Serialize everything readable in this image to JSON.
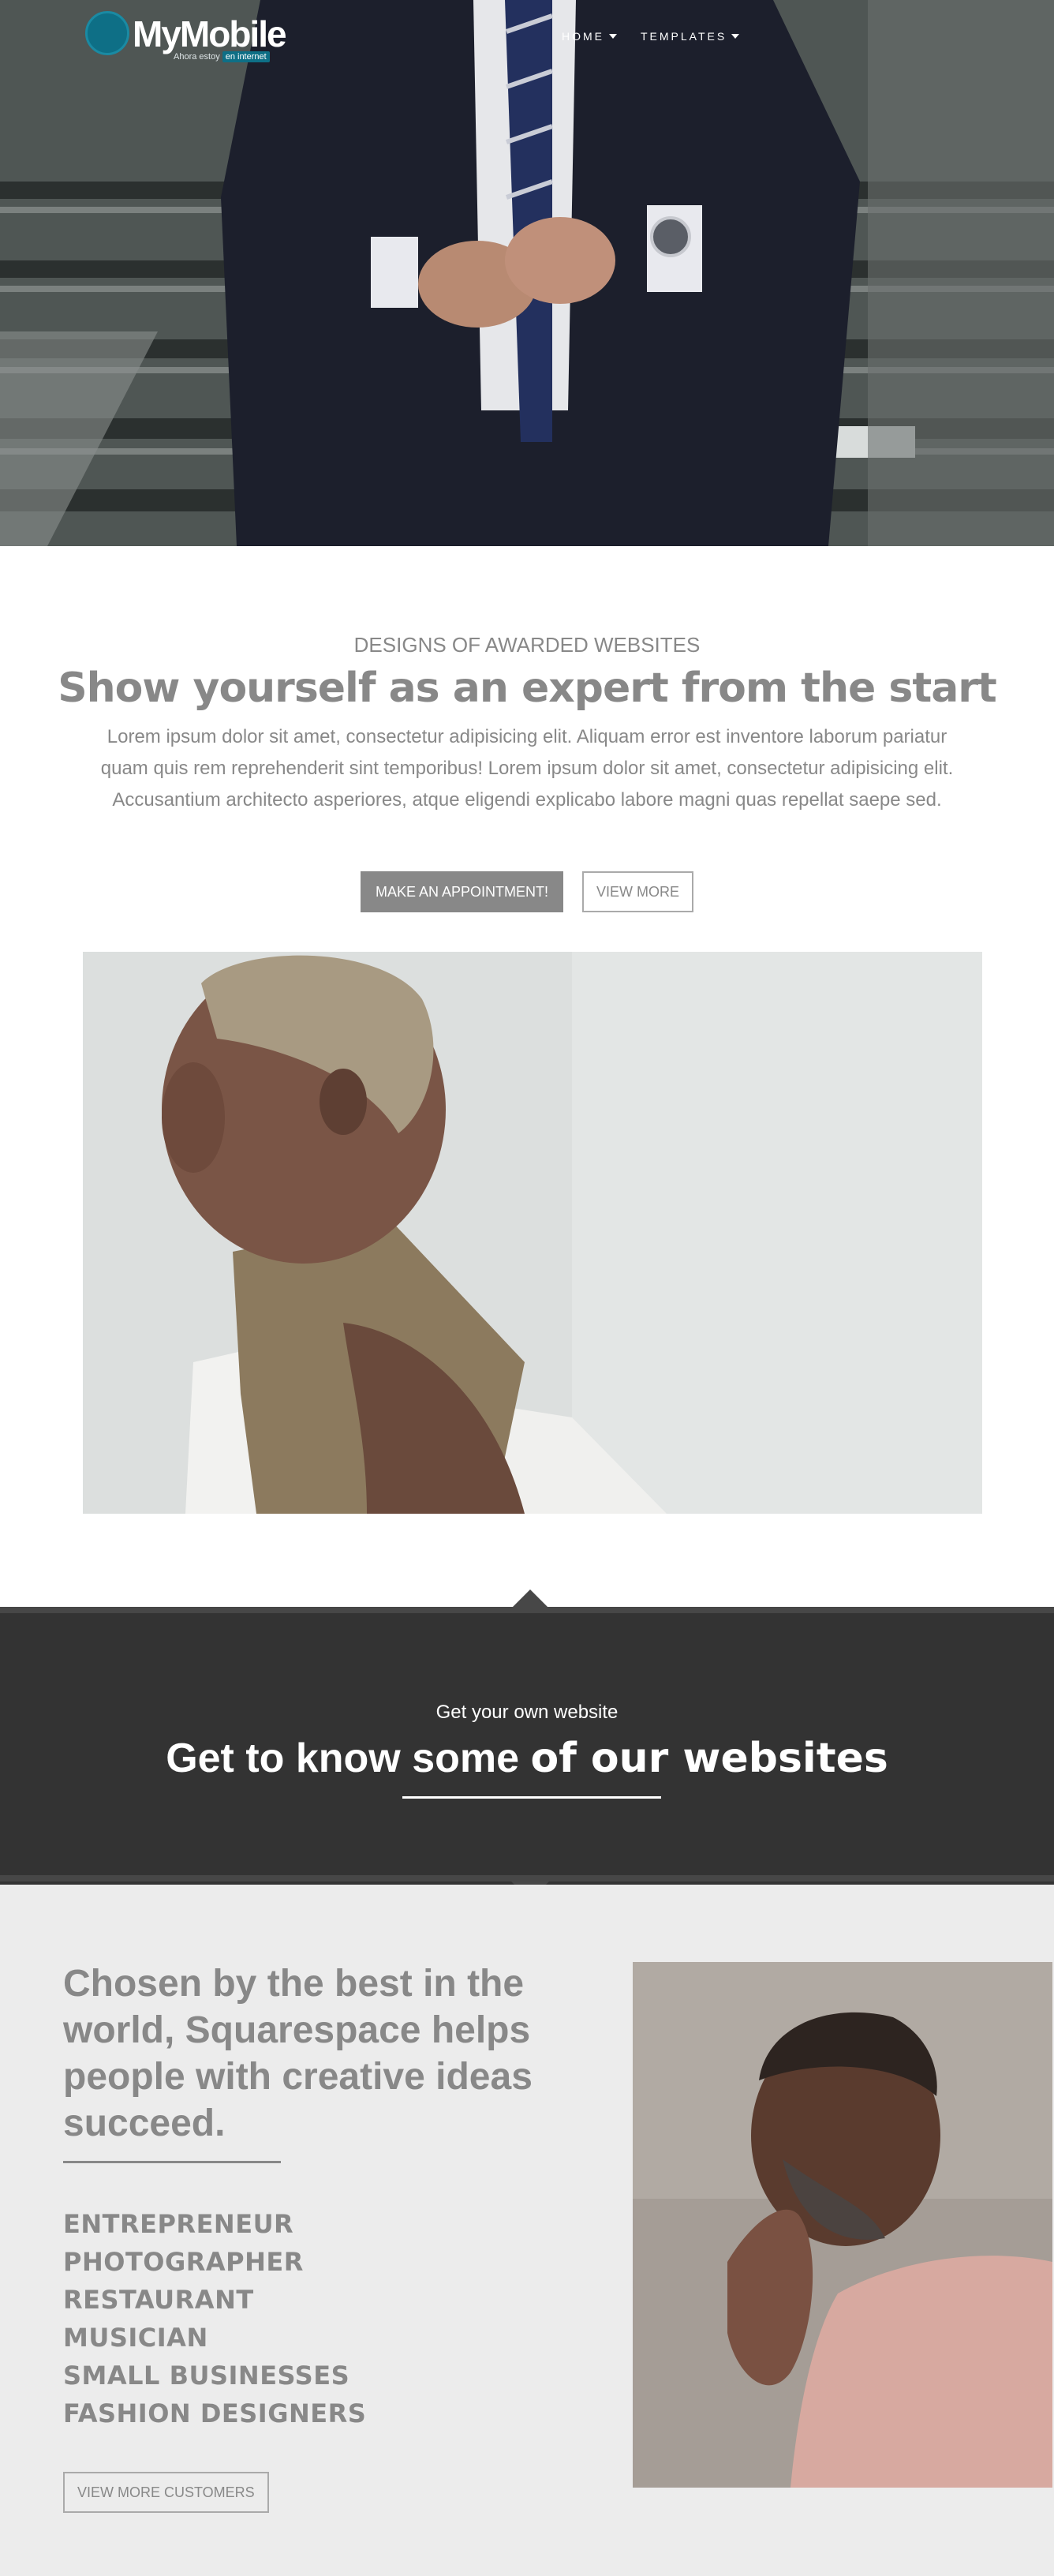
{
  "header": {
    "brand": "MyMobile",
    "tagline": "Ahora estoy",
    "tagline_highlight": "en internet",
    "nav": [
      {
        "label": "HOME"
      },
      {
        "label": "TEMPLATES"
      }
    ]
  },
  "intro": {
    "kicker": "DESIGNS OF AWARDED WEBSITES",
    "headline": "Show yourself as an expert from the start",
    "lead": "Lorem ipsum dolor sit amet, consectetur adipisicing elit. Aliquam error est inventore laborum pariatur quam quis rem reprehenderit sint temporibus! Lorem ipsum dolor sit amet, consectetur adipisicing elit. Accusantium architecto asperiores, atque eligendi explicabo labore magni quas repellat saepe sed.",
    "primary_button": "MAKE AN APPOINTMENT!",
    "secondary_button": "VIEW MORE"
  },
  "band": {
    "subtitle": "Get your own website",
    "title_plain": "Get to know some",
    "title_bold": "of our websites"
  },
  "customers": {
    "title": "Chosen by the best in the world, Squarespace helps people with creative ideas succeed.",
    "list": [
      "ENTREPRENEUR",
      "PHOTOGRAPHER",
      "RESTAURANT",
      "MUSICIAN",
      "SMALL BUSINESSES",
      "FASHION DESIGNERS"
    ],
    "button": "VIEW MORE CUSTOMERS"
  },
  "colors": {
    "accent": "#0e6f86",
    "text_gray": "#888888",
    "dark_band": "#333333",
    "light_section": "#ececec"
  }
}
